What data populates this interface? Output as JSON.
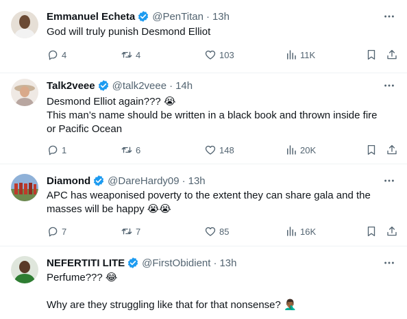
{
  "colors": {
    "text": "#0f1419",
    "muted": "#536471",
    "verified_blue": "#1d9bf0",
    "divider": "#eff3f4"
  },
  "tweets": [
    {
      "name": "Emmanuel Echeta",
      "handle": "@PenTitan",
      "time": "13h",
      "lines": [
        "God will truly punish Desmond Elliot"
      ],
      "replies": "4",
      "retweets": "4",
      "likes": "103",
      "views": "11K"
    },
    {
      "name": "Talk2veee",
      "handle": "@talk2veee",
      "time": "14h",
      "lines": [
        "Desmond Elliot again??? 😭",
        "This man’s name should be written in a black book and thrown inside fire",
        "or Pacific Ocean"
      ],
      "replies": "1",
      "retweets": "6",
      "likes": "148",
      "views": "20K"
    },
    {
      "name": "Diamond",
      "handle": "@DareHardy09",
      "time": "13h",
      "lines": [
        "APC has weaponised poverty to the extent they can share gala and the",
        "masses will be happy 😭😭"
      ],
      "replies": "7",
      "retweets": "7",
      "likes": "85",
      "views": "16K"
    },
    {
      "name": "NEFERTITI LITE",
      "handle": "@FirstObidient",
      "time": "13h",
      "lines": [
        "Perfume??? 😂",
        "",
        "Why are they struggling like that for that nonsense? 🤦🏾‍♂️"
      ]
    }
  ],
  "icons": {
    "verified": "verified-badge-icon",
    "more": "more-horizontal-icon",
    "reply": "reply-icon",
    "retweet": "retweet-icon",
    "like": "heart-icon",
    "views": "views-bar-chart-icon",
    "bookmark": "bookmark-icon",
    "share": "share-icon"
  }
}
